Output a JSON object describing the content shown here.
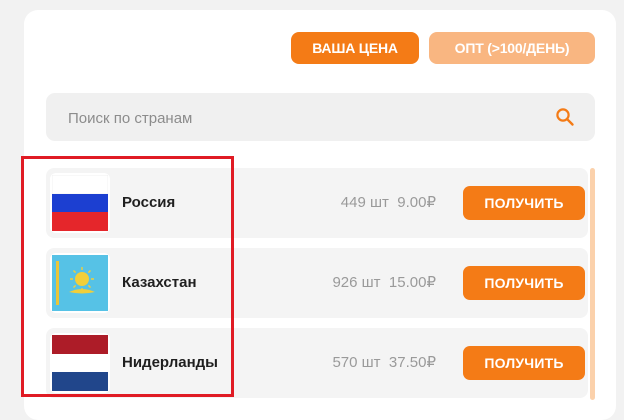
{
  "filters": {
    "your_price": "ВАША ЦЕНА",
    "wholesale": "ОПТ (>100/ДЕНЬ)"
  },
  "search": {
    "placeholder": "Поиск по странам",
    "icon": "search-icon"
  },
  "countries": [
    {
      "name": "Россия",
      "quantity": "449 шт",
      "price": "9.00₽",
      "button": "ПОЛУЧИТЬ",
      "flag": "russia-flag"
    },
    {
      "name": "Казахстан",
      "quantity": "926 шт",
      "price": "15.00₽",
      "button": "ПОЛУЧИТЬ",
      "flag": "kazakhstan-flag"
    },
    {
      "name": "Нидерланды",
      "quantity": "570 шт",
      "price": "37.50₽",
      "button": "ПОЛУЧИТЬ",
      "flag": "netherlands-flag"
    }
  ],
  "colors": {
    "accent": "#f47b16",
    "accent_light": "#f9b681",
    "highlight": "#e01b24"
  }
}
